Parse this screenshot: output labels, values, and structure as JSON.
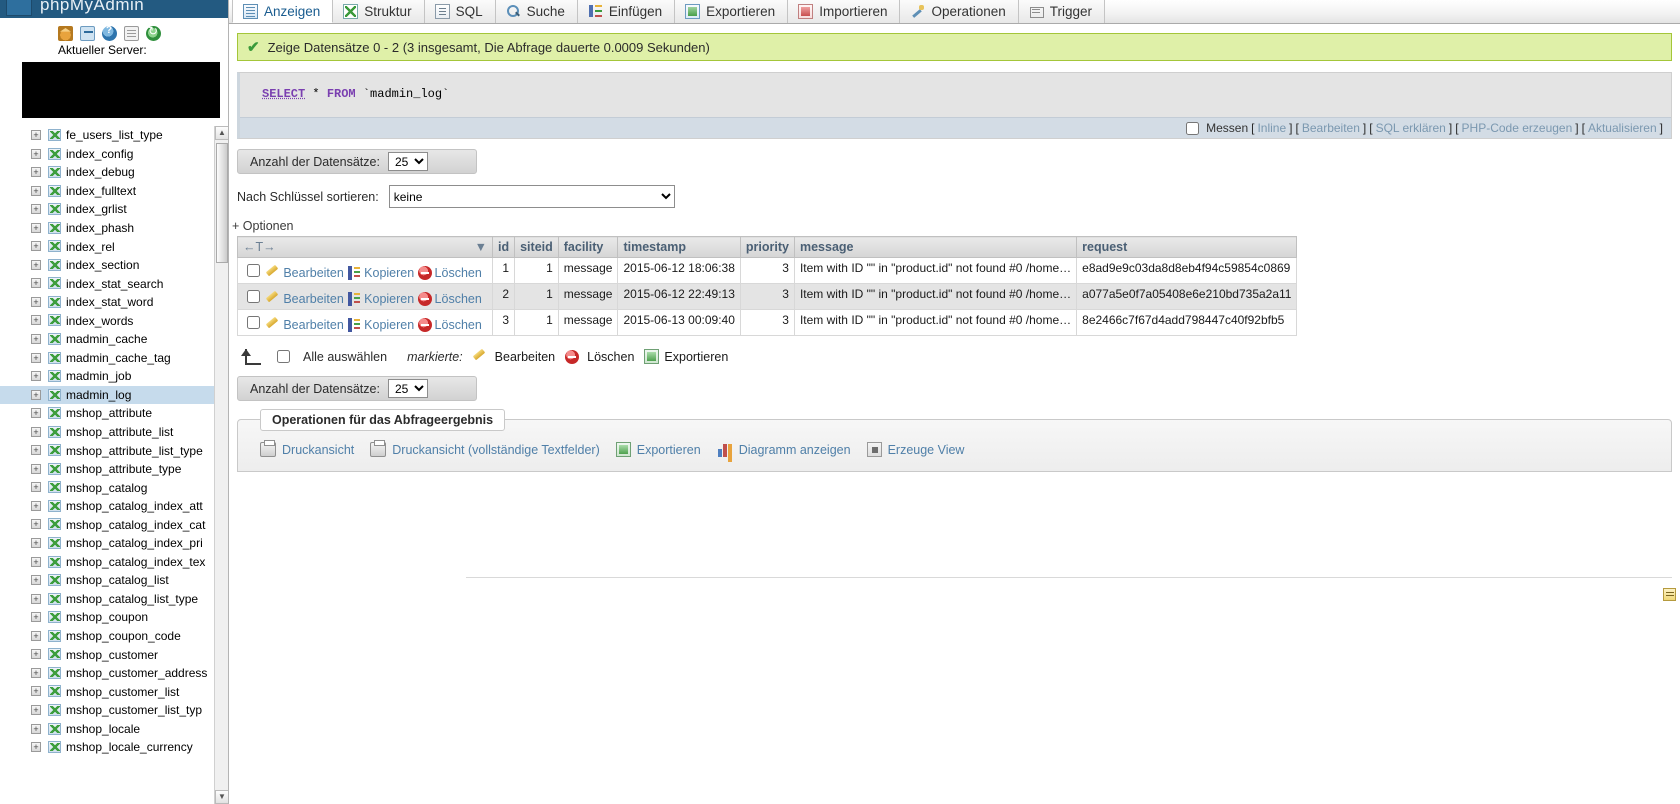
{
  "app": {
    "brand": "phpMyAdmin"
  },
  "sidebar": {
    "server_label": "Aktueller Server:",
    "server_value": "",
    "icons": [
      {
        "name": "home-icon",
        "title": "Startseite"
      },
      {
        "name": "logout-icon",
        "title": "Abmelden"
      },
      {
        "name": "help-icon",
        "title": "Hilfe"
      },
      {
        "name": "docs-icon",
        "title": "Dokumentation"
      },
      {
        "name": "reload-icon",
        "title": "Neu laden"
      }
    ],
    "tables": [
      {
        "label": "fe_users_list_type",
        "selected": false
      },
      {
        "label": "index_config",
        "selected": false
      },
      {
        "label": "index_debug",
        "selected": false
      },
      {
        "label": "index_fulltext",
        "selected": false
      },
      {
        "label": "index_grlist",
        "selected": false
      },
      {
        "label": "index_phash",
        "selected": false
      },
      {
        "label": "index_rel",
        "selected": false
      },
      {
        "label": "index_section",
        "selected": false
      },
      {
        "label": "index_stat_search",
        "selected": false
      },
      {
        "label": "index_stat_word",
        "selected": false
      },
      {
        "label": "index_words",
        "selected": false
      },
      {
        "label": "madmin_cache",
        "selected": false
      },
      {
        "label": "madmin_cache_tag",
        "selected": false
      },
      {
        "label": "madmin_job",
        "selected": false
      },
      {
        "label": "madmin_log",
        "selected": true
      },
      {
        "label": "mshop_attribute",
        "selected": false
      },
      {
        "label": "mshop_attribute_list",
        "selected": false
      },
      {
        "label": "mshop_attribute_list_type",
        "selected": false
      },
      {
        "label": "mshop_attribute_type",
        "selected": false
      },
      {
        "label": "mshop_catalog",
        "selected": false
      },
      {
        "label": "mshop_catalog_index_att",
        "selected": false
      },
      {
        "label": "mshop_catalog_index_cat",
        "selected": false
      },
      {
        "label": "mshop_catalog_index_pri",
        "selected": false
      },
      {
        "label": "mshop_catalog_index_tex",
        "selected": false
      },
      {
        "label": "mshop_catalog_list",
        "selected": false
      },
      {
        "label": "mshop_catalog_list_type",
        "selected": false
      },
      {
        "label": "mshop_coupon",
        "selected": false
      },
      {
        "label": "mshop_coupon_code",
        "selected": false
      },
      {
        "label": "mshop_customer",
        "selected": false
      },
      {
        "label": "mshop_customer_address",
        "selected": false
      },
      {
        "label": "mshop_customer_list",
        "selected": false
      },
      {
        "label": "mshop_customer_list_typ",
        "selected": false
      },
      {
        "label": "mshop_locale",
        "selected": false
      },
      {
        "label": "mshop_locale_currency",
        "selected": false
      }
    ]
  },
  "tabs": [
    {
      "label": "Anzeigen",
      "icon": "browse-icon",
      "active": true
    },
    {
      "label": "Struktur",
      "icon": "structure-icon",
      "active": false
    },
    {
      "label": "SQL",
      "icon": "sql-icon",
      "active": false
    },
    {
      "label": "Suche",
      "icon": "search-icon",
      "active": false
    },
    {
      "label": "Einfügen",
      "icon": "insert-icon",
      "active": false
    },
    {
      "label": "Exportieren",
      "icon": "export-icon",
      "active": false
    },
    {
      "label": "Importieren",
      "icon": "import-icon",
      "active": false
    },
    {
      "label": "Operationen",
      "icon": "operations-icon",
      "active": false
    },
    {
      "label": "Trigger",
      "icon": "trigger-icon",
      "active": false
    }
  ],
  "status": {
    "icon": "success-check-icon",
    "message": "Zeige Datensätze 0 - 2 (3 insgesamt, Die Abfrage dauerte 0.0009 Sekunden)"
  },
  "sql": {
    "keyword_select": "SELECT",
    "star": "*",
    "keyword_from": "FROM",
    "table": "`madmin_log`",
    "footer": {
      "profiling_label": "Messen",
      "links": [
        "Inline",
        "Bearbeiten",
        "SQL erklären",
        "PHP-Code erzeugen",
        "Aktualisieren"
      ]
    }
  },
  "controls": {
    "rows_label_top": "Anzahl der Datensätze:",
    "rows_value_top": "25",
    "rows_label_bottom": "Anzahl der Datensätze:",
    "rows_value_bottom": "25",
    "sort_label": "Nach Schlüssel sortieren:",
    "sort_value": "keine",
    "options_link": "+ Optionen"
  },
  "table": {
    "sort_header": "←T→",
    "columns": [
      "id",
      "siteid",
      "facility",
      "timestamp",
      "priority",
      "message",
      "request"
    ],
    "row_actions": {
      "edit": "Bearbeiten",
      "copy": "Kopieren",
      "delete": "Löschen"
    },
    "rows": [
      {
        "id": "1",
        "siteid": "1",
        "facility": "message",
        "timestamp": "2015-06-12 18:06:38",
        "priority": "3",
        "message": "Item with ID \"\" in \"product.id\" not found #0 /home…",
        "request": "e8ad9e9c03da8d8eb4f94c59854c0869"
      },
      {
        "id": "2",
        "siteid": "1",
        "facility": "message",
        "timestamp": "2015-06-12 22:49:13",
        "priority": "3",
        "message": "Item with ID \"\" in \"product.id\" not found #0 /home…",
        "request": "a077a5e0f7a05408e6e210bd735a2a11"
      },
      {
        "id": "3",
        "siteid": "1",
        "facility": "message",
        "timestamp": "2015-06-13 00:09:40",
        "priority": "3",
        "message": "Item with ID \"\" in \"product.id\" not found #0 /home…",
        "request": "8e2466c7f67d4add798447c40f92bfb5"
      }
    ]
  },
  "selectbar": {
    "check_all": "Alle auswählen",
    "with_selected": "markierte:",
    "edit": "Bearbeiten",
    "delete": "Löschen",
    "export": "Exportieren"
  },
  "query_ops": {
    "legend": "Operationen für das Abfrageergebnis",
    "links": [
      {
        "label": "Druckansicht",
        "icon": "print-icon"
      },
      {
        "label": "Druckansicht (vollständige Textfelder)",
        "icon": "print-full-icon"
      },
      {
        "label": "Exportieren",
        "icon": "export-icon"
      },
      {
        "label": "Diagramm anzeigen",
        "icon": "chart-icon"
      },
      {
        "label": "Erzeuge View",
        "icon": "create-view-icon"
      }
    ]
  },
  "colors": {
    "success_bg": "#dff0a8",
    "success_border": "#a4c639",
    "accent_link": "#4f7fa8",
    "selected_row": "#c6dbec",
    "brand": "#235a81"
  }
}
